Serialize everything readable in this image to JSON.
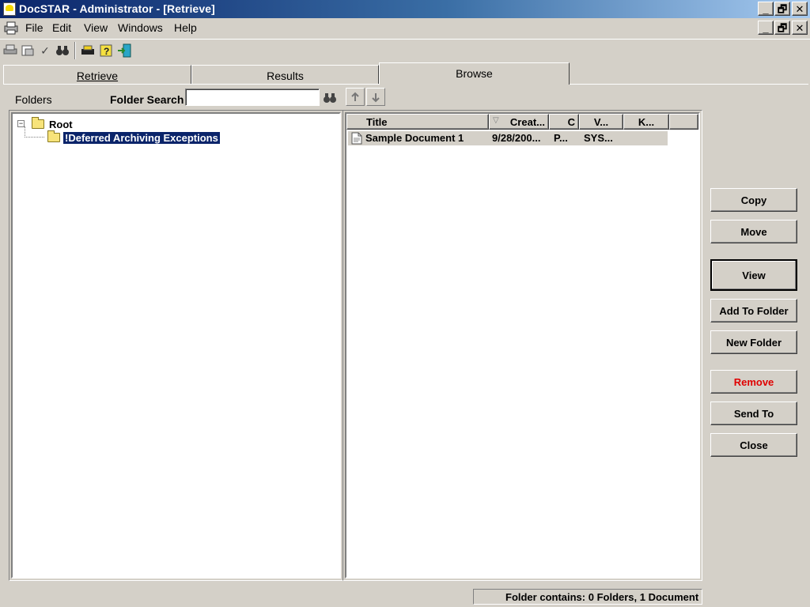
{
  "window": {
    "title": "DocSTAR - Administrator - [Retrieve]",
    "controls": {
      "minimize": "_",
      "restore": "🗗",
      "close": "✕"
    }
  },
  "menu": {
    "items": [
      "File",
      "Edit",
      "View",
      "Windows",
      "Help"
    ]
  },
  "toolbar": {
    "icons": [
      "printer-icon",
      "scan-icon",
      "checkmark-icon",
      "binoculars-icon",
      "fax-icon",
      "help-icon",
      "exit-door-icon"
    ]
  },
  "tabs": [
    {
      "label": "Retrieve",
      "active": false
    },
    {
      "label": "Results",
      "active": false
    },
    {
      "label": "Browse",
      "active": true
    }
  ],
  "browse": {
    "folders_label": "Folders",
    "folder_search_label": "Folder Search",
    "folder_search_value": ""
  },
  "tree": {
    "root": "Root",
    "children": [
      "!Deferred Archiving Exceptions"
    ],
    "selected": "!Deferred Archiving Exceptions"
  },
  "list": {
    "columns": [
      "Title",
      "Creat...",
      "C",
      "V...",
      "K..."
    ],
    "rows": [
      {
        "title": "Sample Document 1",
        "created": "9/28/200...",
        "c": "P...",
        "v": "SYS...",
        "k": ""
      }
    ]
  },
  "buttons": {
    "copy": "Copy",
    "move": "Move",
    "view": "View",
    "add_to_folder": "Add To Folder",
    "new_folder": "New Folder",
    "remove": "Remove",
    "send_to": "Send To",
    "close": "Close"
  },
  "colors": {
    "remove_text": "#e00000",
    "selection": "#0a246a",
    "face": "#d4d0c8"
  },
  "status": {
    "text": "Folder contains: 0 Folders, 1 Document"
  }
}
